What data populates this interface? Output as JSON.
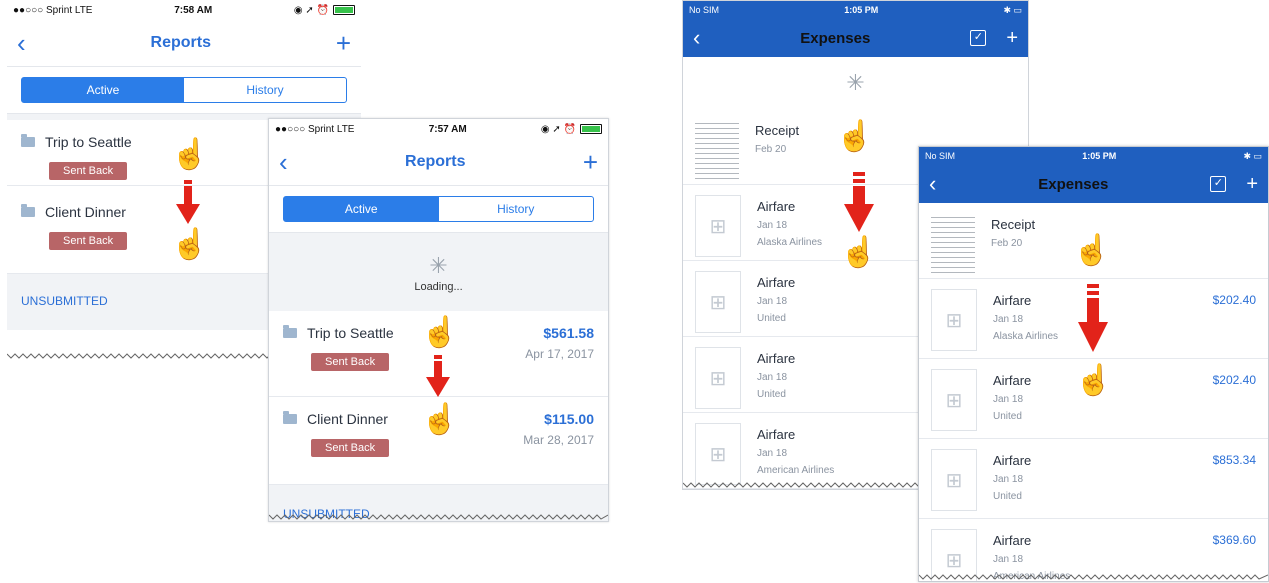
{
  "reports_before": {
    "status": {
      "carrier": "●●○○○ Sprint  LTE",
      "time": "7:58 AM"
    },
    "title": "Reports",
    "tabs": [
      "Active",
      "History"
    ],
    "rows": [
      {
        "name": "Trip to Seattle",
        "badge": "Sent Back"
      },
      {
        "name": "Client Dinner",
        "badge": "Sent Back"
      }
    ],
    "section": "UNSUBMITTED"
  },
  "reports_after": {
    "status": {
      "carrier": "●●○○○ Sprint  LTE",
      "time": "7:57 AM"
    },
    "title": "Reports",
    "tabs": [
      "Active",
      "History"
    ],
    "loading": "Loading...",
    "rows": [
      {
        "name": "Trip to Seattle",
        "badge": "Sent Back",
        "amount": "$561.58",
        "date": "Apr 17, 2017"
      },
      {
        "name": "Client Dinner",
        "badge": "Sent Back",
        "amount": "$115.00",
        "date": "Mar 28, 2017"
      }
    ],
    "section": "UNSUBMITTED"
  },
  "expenses_before": {
    "status": {
      "carrier": "No SIM",
      "time": "1:05 PM"
    },
    "title": "Expenses",
    "rows": [
      {
        "title": "Receipt",
        "date": "Feb 20",
        "vendor": ""
      },
      {
        "title": "Airfare",
        "date": "Jan 18",
        "vendor": "Alaska Airlines"
      },
      {
        "title": "Airfare",
        "date": "Jan 18",
        "vendor": "United"
      },
      {
        "title": "Airfare",
        "date": "Jan 18",
        "vendor": "United"
      },
      {
        "title": "Airfare",
        "date": "Jan 18",
        "vendor": "American Airlines"
      }
    ]
  },
  "expenses_after": {
    "status": {
      "carrier": "No SIM",
      "time": "1:05 PM"
    },
    "title": "Expenses",
    "rows": [
      {
        "title": "Receipt",
        "date": "Feb 20",
        "vendor": "",
        "amount": ""
      },
      {
        "title": "Airfare",
        "date": "Jan 18",
        "vendor": "Alaska Airlines",
        "amount": "$202.40"
      },
      {
        "title": "Airfare",
        "date": "Jan 18",
        "vendor": "United",
        "amount": "$202.40"
      },
      {
        "title": "Airfare",
        "date": "Jan 18",
        "vendor": "United",
        "amount": "$853.34"
      },
      {
        "title": "Airfare",
        "date": "Jan 18",
        "vendor": "American Airlines",
        "amount": "$369.60"
      }
    ]
  },
  "colors": {
    "accent": "#2b7de8",
    "badge": "#b86567",
    "nav_dark": "#1f5fbf",
    "arrow": "#e2231a"
  }
}
